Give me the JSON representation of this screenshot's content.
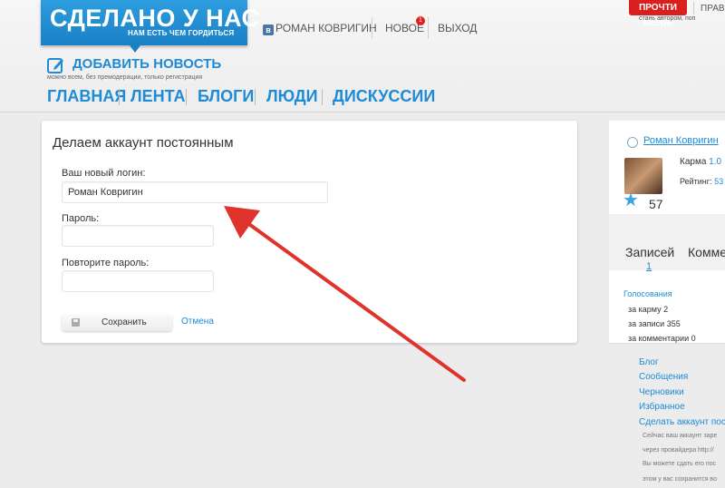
{
  "logo": {
    "title": "СДЕЛАНО У НАС",
    "subtitle": "НАМ ЕСТЬ ЧЕМ ГОРДИТЬСЯ"
  },
  "usernav": {
    "user": "РОМАН КОВРИГИН",
    "news": "НОВОЕ",
    "news_badge": "1",
    "logout": "ВЫХОД"
  },
  "promo": {
    "readme": "ПРОЧТИ МЕНЯ!",
    "rules": "ПРАВИ",
    "readme_sub": "стань автором, поп"
  },
  "add_news": {
    "label": "ДОБАВИТЬ НОВОСТЬ",
    "sub": "можно всем, без премодерации, только регистрация"
  },
  "mainnav": [
    "ГЛАВНАЯ",
    "ЛЕНТА",
    "БЛОГИ",
    "ЛЮДИ",
    "ДИСКУССИИ"
  ],
  "form": {
    "title": "Делаем аккаунт постоянным",
    "login_label": "Ваш новый логин:",
    "login_value": "Роман Ковригин",
    "password_label": "Пароль:",
    "password_value": "",
    "repeat_label": "Повторите пароль:",
    "repeat_value": "",
    "save": "Сохранить",
    "cancel": "Отмена"
  },
  "sidebar": {
    "user": "Роман Ковригин",
    "karma_label": "Карма",
    "karma_value": "1.0",
    "rating_label": "Рейтинг:",
    "rating_value": "53",
    "score": "57",
    "tab_posts": "Записей",
    "tab_posts_count": "1",
    "tab_comments": "Комме",
    "votes_heading": "Голосования",
    "votes": [
      "за карму 2",
      "за записи 355",
      "за комментарии 0"
    ],
    "links": [
      "Блог",
      "Сообщения",
      "Черновики",
      "Избранное",
      "Сделать аккаунт пост"
    ],
    "notes": [
      "Сейчас ваш аккаунт заре",
      "через провайдера http://",
      "Вы можете сдать его пос",
      "этом у вас сохранится во"
    ]
  },
  "colors": {
    "accent": "#1d8bd6",
    "arrow": "#e0332b",
    "promo": "#d9201f"
  }
}
